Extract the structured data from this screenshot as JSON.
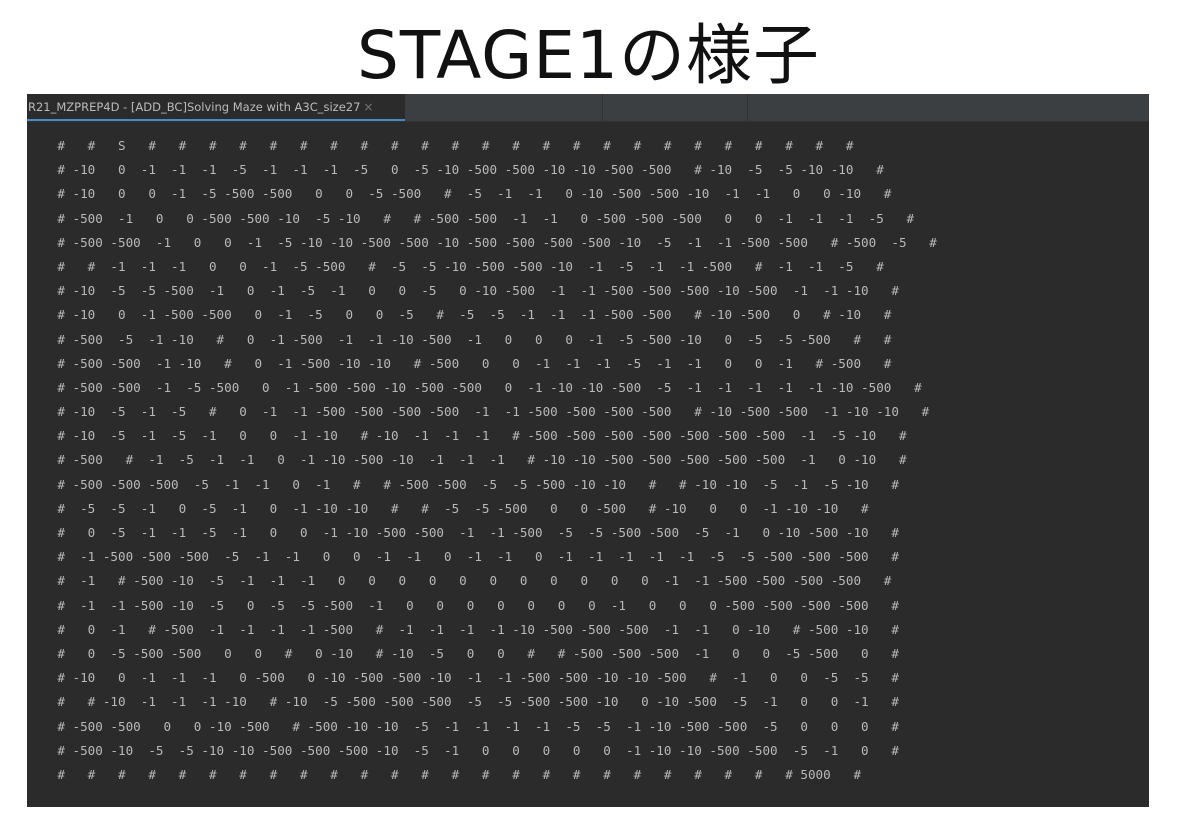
{
  "slide": {
    "title": "STAGE1の様子"
  },
  "tab": {
    "title": "R21_MZPREP4D - [ADD_BC]Solving Maze with A3C_size27",
    "close_icon": "×"
  },
  "console": {
    "lines": [
      "    #   #   S   #   #   #   #   #   #   #   #   #   #   #   #   #   #   #   #   #   #   #   #   #   #   #   #",
      "    # -10   0  -1  -1  -1  -5  -1  -1  -1  -5   0  -5 -10 -500 -500 -10 -10 -500 -500   # -10  -5  -5 -10 -10   #",
      "    # -10   0   0  -1  -5 -500 -500   0   0  -5 -500   #  -5  -1  -1   0 -10 -500 -500 -10  -1  -1   0   0 -10   #",
      "    # -500  -1   0   0 -500 -500 -10  -5 -10   #   # -500 -500  -1  -1   0 -500 -500 -500   0   0  -1  -1  -1  -5   #",
      "    # -500 -500  -1   0   0  -1  -5 -10 -10 -500 -500 -10 -500 -500 -500 -500 -10  -5  -1  -1 -500 -500   # -500  -5   #",
      "    #   #  -1  -1  -1   0   0  -1  -5 -500   #  -5  -5 -10 -500 -500 -10  -1  -5  -1  -1 -500   #  -1  -1  -5   #",
      "    # -10  -5  -5 -500  -1   0  -1  -5  -1   0   0  -5   0 -10 -500  -1  -1 -500 -500 -500 -10 -500  -1  -1 -10   #",
      "    # -10   0  -1 -500 -500   0  -1  -5   0   0  -5   #  -5  -5  -1  -1  -1 -500 -500   # -10 -500   0   # -10   #",
      "    # -500  -5  -1 -10   #   0  -1 -500  -1  -1 -10 -500  -1   0   0   0  -1  -5 -500 -10   0  -5  -5 -500   #   #",
      "    # -500 -500  -1 -10   #   0  -1 -500 -10 -10   # -500   0   0  -1  -1  -1  -5  -1  -1   0   0  -1   # -500   #",
      "    # -500 -500  -1  -5 -500   0  -1 -500 -500 -10 -500 -500   0  -1 -10 -10 -500  -5  -1  -1  -1  -1  -1 -10 -500   #",
      "    # -10  -5  -1  -5   #   0  -1  -1 -500 -500 -500 -500  -1  -1 -500 -500 -500 -500   # -10 -500 -500  -1 -10 -10   #",
      "    # -10  -5  -1  -5  -1   0   0  -1 -10   # -10  -1  -1  -1   # -500 -500 -500 -500 -500 -500 -500  -1  -5 -10   #",
      "    # -500   #  -1  -5  -1  -1   0  -1 -10 -500 -10  -1  -1  -1   # -10 -10 -500 -500 -500 -500 -500  -1   0 -10   #",
      "    # -500 -500 -500  -5  -1  -1   0  -1   #   # -500 -500  -5  -5 -500 -10 -10   #   # -10 -10  -5  -1  -5 -10   #",
      "    #  -5  -5  -1   0  -5  -1   0  -1 -10 -10   #   #  -5  -5 -500   0   0 -500   # -10   0   0  -1 -10 -10   #",
      "    #   0  -5  -1  -1  -5  -1   0   0  -1 -10 -500 -500  -1  -1 -500  -5  -5 -500 -500  -5  -1   0 -10 -500 -10   #",
      "    #  -1 -500 -500 -500  -5  -1  -1   0   0  -1  -1   0  -1  -1   0  -1  -1  -1  -1  -1  -5  -5 -500 -500 -500   #",
      "    #  -1   # -500 -10  -5  -1  -1  -1   0   0   0   0   0   0   0   0   0   0   0  -1  -1 -500 -500 -500 -500   #",
      "    #  -1  -1 -500 -10  -5   0  -5  -5 -500  -1   0   0   0   0   0   0   0  -1   0   0   0 -500 -500 -500 -500   #",
      "    #   0  -1   # -500  -1  -1  -1  -1 -500   #  -1  -1  -1  -1 -10 -500 -500 -500  -1  -1   0 -10   # -500 -10   #",
      "    #   0  -5 -500 -500   0   0   #   0 -10   # -10  -5   0   0   #   # -500 -500 -500  -1   0   0  -5 -500   0   #",
      "    # -10   0  -1  -1  -1   0 -500   0 -10 -500 -500 -10  -1  -1 -500 -500 -10 -10 -500   #  -1   0   0  -5  -5   #",
      "    #   # -10  -1  -1  -1 -10   # -10  -5 -500 -500 -500  -5  -5 -500 -500 -10   0 -10 -500  -5  -1   0   0  -1   #",
      "    # -500 -500   0   0 -10 -500   # -500 -10 -10  -5  -1  -1  -1  -1  -5  -5  -1 -10 -500 -500  -5   0   0   0   #",
      "    # -500 -10  -5  -5 -10 -10 -500 -500 -500 -10  -5  -1   0   0   0   0   0  -1 -10 -10 -500 -500  -5  -1   0   #",
      "    #   #   #   #   #   #   #   #   #   #   #   #   #   #   #   #   #   #   #   #   #   #   #   #   # 5000   #"
    ]
  }
}
